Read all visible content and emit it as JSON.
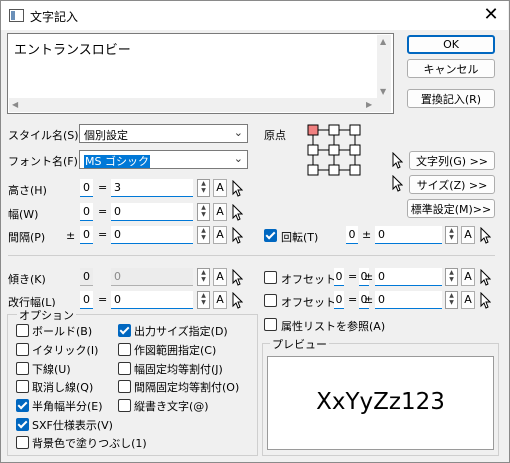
{
  "window": {
    "title": "文字記入",
    "close_symbol": "✕"
  },
  "text_area": {
    "content": "エントランスロビー"
  },
  "buttons": {
    "ok": "OK",
    "cancel": "キャンセル",
    "replace": "置換記入(R)",
    "char_list": "文字列(G) >>",
    "size": "サイズ(Z) >>",
    "standard": "標準設定(M)>>"
  },
  "style_name": {
    "label": "スタイル名(S)",
    "value": "個別設定"
  },
  "font_name": {
    "label": "フォント名(F)",
    "value": "MS ゴシック"
  },
  "origin_label": "原点",
  "height": {
    "label": "高さ(H)",
    "prefix": "0",
    "eq": "=",
    "value": "3"
  },
  "width": {
    "label": "幅(W)",
    "prefix": "0",
    "eq": "=",
    "value": "0"
  },
  "spacing": {
    "label": "間隔(P)",
    "pm": "±",
    "prefix": "0",
    "eq": "=",
    "value": "0"
  },
  "rotation": {
    "label": "回転(T)",
    "prefix": "0",
    "pm": "±",
    "value": "0",
    "checked": true
  },
  "slant": {
    "label": "傾き(K)",
    "prefix": "0",
    "value": "0"
  },
  "line_spacing": {
    "label": "改行幅(L)",
    "prefix": "0",
    "eq": "=",
    "value": "0"
  },
  "offset_x": {
    "label": "オフセットX",
    "prefix": "0",
    "eq": "=",
    "pm": "±",
    "value": "0",
    "checked": false
  },
  "offset_y": {
    "label": "オフセットY",
    "prefix": "0",
    "eq": "=",
    "pm": "±",
    "value": "0",
    "checked": false
  },
  "attr_ref": {
    "label": "属性リストを参照(A)",
    "checked": false
  },
  "options": {
    "title": "オプション",
    "left": [
      {
        "label": "ボールド(B)",
        "checked": false
      },
      {
        "label": "イタリック(I)",
        "checked": false
      },
      {
        "label": "下線(U)",
        "checked": false
      },
      {
        "label": "取消し線(Q)",
        "checked": false
      },
      {
        "label": "半角幅半分(E)",
        "checked": true
      },
      {
        "label": "SXF仕様表示(V)",
        "checked": true
      },
      {
        "label": "背景色で塗りつぶし(1)",
        "checked": false
      }
    ],
    "right": [
      {
        "label": "出力サイズ指定(D)",
        "checked": true
      },
      {
        "label": "作図範囲指定(C)",
        "checked": false
      },
      {
        "label": "幅固定均等割付(J)",
        "checked": false
      },
      {
        "label": "間隔固定均等割付(O)",
        "checked": false
      },
      {
        "label": "縦書き文字(@)",
        "checked": false
      }
    ]
  },
  "preview": {
    "title": "プレビュー",
    "text": "XxYyZz123"
  },
  "field_button_label": "A",
  "colors": {
    "accent": "#0067c0",
    "origin_marker": "#f08080"
  }
}
